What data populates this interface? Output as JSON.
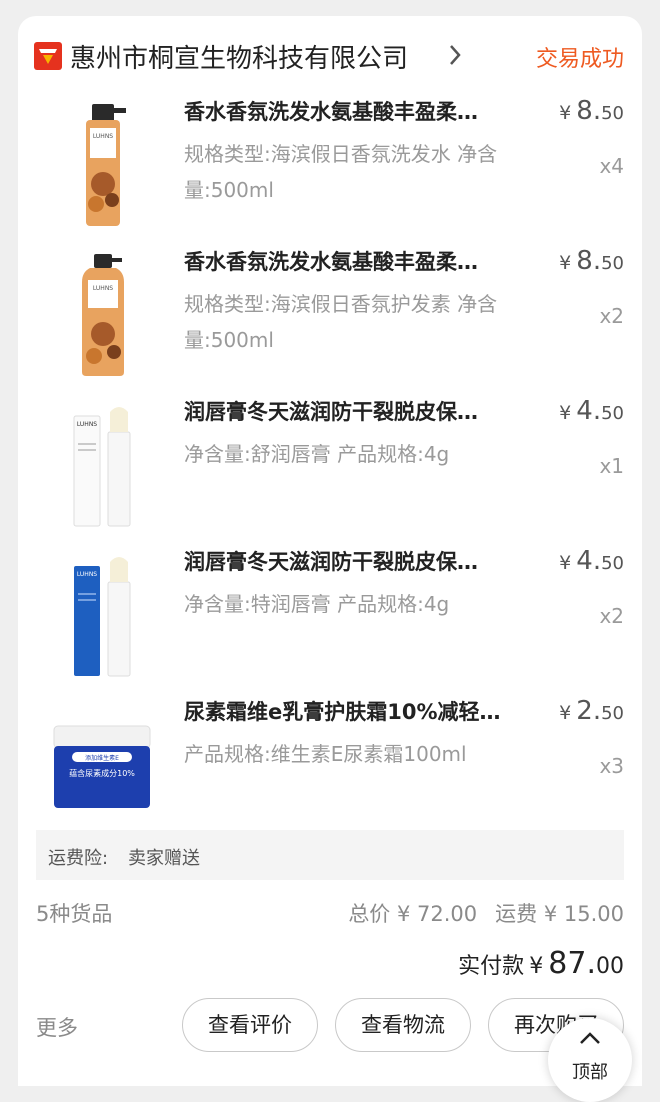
{
  "shop": {
    "name": "惠州市桐宣生物科技有限公司",
    "status": "交易成功",
    "icon": "shop-icon",
    "status_color": "#ee5a21"
  },
  "items": [
    {
      "title": "香水香氛洗发水氨基酸丰盈柔…",
      "spec": "规格类型:海滨假日香氛洗发水 净含量:500ml",
      "price_cur": "¥",
      "price_int": "8.",
      "price_dec": "50",
      "qty": "x4",
      "thumb_brand": "LUHNS"
    },
    {
      "title": "香水香氛洗发水氨基酸丰盈柔…",
      "spec": "规格类型:海滨假日香氛护发素 净含量:500ml",
      "price_cur": "¥",
      "price_int": "8.",
      "price_dec": "50",
      "qty": "x2",
      "thumb_brand": "LUHNS"
    },
    {
      "title": "润唇膏冬天滋润防干裂脱皮保…",
      "spec": "净含量:舒润唇膏 产品规格:4g",
      "price_cur": "¥",
      "price_int": "4.",
      "price_dec": "50",
      "qty": "x1",
      "thumb_brand": "LUHNS"
    },
    {
      "title": "润唇膏冬天滋润防干裂脱皮保…",
      "spec": "净含量:特润唇膏 产品规格:4g",
      "price_cur": "¥",
      "price_int": "4.",
      "price_dec": "50",
      "qty": "x2",
      "thumb_brand": "LUHNS"
    },
    {
      "title": "尿素霜维e乳膏护肤霜10%减轻…",
      "spec": "产品规格:维生素E尿素霜100ml",
      "price_cur": "¥",
      "price_int": "2.",
      "price_dec": "50",
      "qty": "x3",
      "thumb_label_1": "添加维生素E",
      "thumb_label_2": "蕴含尿素成分10%"
    }
  ],
  "insurance": {
    "label": "运费险:",
    "value": "卖家赠送"
  },
  "summary": {
    "count": "5种货品",
    "total": "总价 ¥ 72.00",
    "shipping": "运费 ¥ 15.00",
    "paid_label": "实付款",
    "paid_cur": "¥",
    "paid_int": "87.",
    "paid_dec": "00"
  },
  "actions": {
    "more": "更多",
    "review": "查看评价",
    "logistics": "查看物流",
    "rebuy": "再次购买"
  },
  "to_top": {
    "label": "顶部",
    "icon": "chevron-up-icon"
  }
}
